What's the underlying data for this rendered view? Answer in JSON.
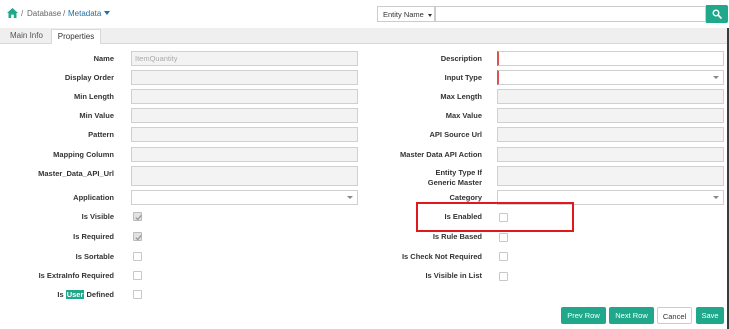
{
  "breadcrumb": {
    "sep1": "/",
    "database": "Database",
    "sep2": "/",
    "metadata": "Metadata"
  },
  "search": {
    "entity_select_value": "Entity Name",
    "query": ""
  },
  "tabs": [
    {
      "label": "Main Info"
    },
    {
      "label": "Properties"
    }
  ],
  "form": {
    "left": [
      {
        "label": "Name",
        "value": "ItemQuantity"
      },
      {
        "label": "Display Order",
        "value": ""
      },
      {
        "label": "Min Length",
        "value": ""
      },
      {
        "label": "Min Value",
        "value": ""
      },
      {
        "label": "Pattern",
        "value": ""
      },
      {
        "label": "Mapping Column",
        "value": ""
      },
      {
        "label": "Master_Data_API_Url",
        "value": ""
      },
      {
        "label": "Application",
        "value": ""
      }
    ],
    "right": [
      {
        "label": "Description",
        "value": ""
      },
      {
        "label": "Input Type",
        "value": ""
      },
      {
        "label": "Max Length",
        "value": ""
      },
      {
        "label": "Max Value",
        "value": ""
      },
      {
        "label": "API Source Url",
        "value": ""
      },
      {
        "label": "Master Data API Action",
        "value": ""
      },
      {
        "label": "Entity Type If Generic Master",
        "value": ""
      },
      {
        "label": "Category",
        "value": ""
      }
    ],
    "checks_left": [
      {
        "label": "Is Visible",
        "checked": true
      },
      {
        "label": "Is Required",
        "checked": true
      },
      {
        "label": "Is Sortable",
        "checked": false
      },
      {
        "label": "Is ExtraInfo Required",
        "checked": false
      },
      {
        "label_pre": "Is ",
        "label_hl": "User",
        "label_post": " Defined",
        "checked": false
      }
    ],
    "checks_right": [
      {
        "label": "Is Enabled",
        "checked": false
      },
      {
        "label": "Is Rule Based",
        "checked": false
      },
      {
        "label": "Is Check Not Required",
        "checked": false
      },
      {
        "label": "Is Visible in List",
        "checked": false
      }
    ]
  },
  "buttons": {
    "prev_row": "Prev Row",
    "next_row": "Next Row",
    "cancel": "Cancel",
    "save": "Save"
  },
  "colors": {
    "accent": "#1fa88a",
    "highlight": "#e0191c",
    "required": "#d9534f",
    "link": "#1f6fa8"
  },
  "icons": {
    "home": "home-icon",
    "search": "search-icon",
    "caret": "caret-down-icon"
  }
}
